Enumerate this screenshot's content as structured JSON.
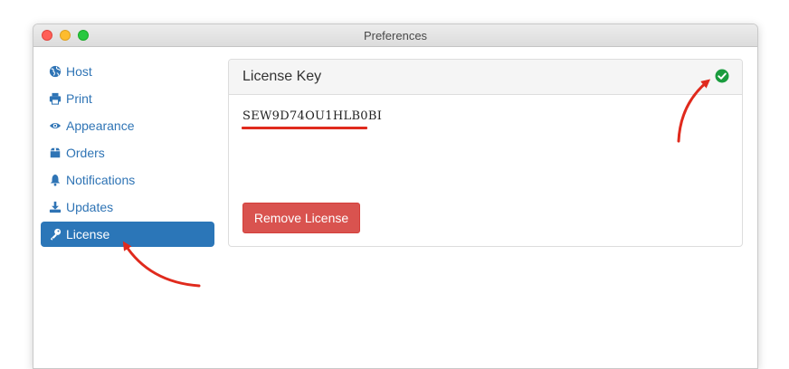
{
  "window": {
    "title": "Preferences"
  },
  "sidebar": {
    "items": [
      {
        "label": "Host",
        "icon": "globe-icon",
        "active": false
      },
      {
        "label": "Print",
        "icon": "printer-icon",
        "active": false
      },
      {
        "label": "Appearance",
        "icon": "eye-icon",
        "active": false
      },
      {
        "label": "Orders",
        "icon": "box-icon",
        "active": false
      },
      {
        "label": "Notifications",
        "icon": "bell-icon",
        "active": false
      },
      {
        "label": "Updates",
        "icon": "download-icon",
        "active": false
      },
      {
        "label": "License",
        "icon": "key-icon",
        "active": true
      }
    ]
  },
  "license_panel": {
    "title": "License Key",
    "status_icon": "check-circle-icon",
    "status_color": "#1a9c3e",
    "key": "SEW9D74OU1HLB0BI",
    "remove_label": "Remove License"
  },
  "colors": {
    "accent": "#2b76b8",
    "link": "#2f74b5",
    "danger": "#d9534f",
    "annotation": "#e02a1d"
  }
}
